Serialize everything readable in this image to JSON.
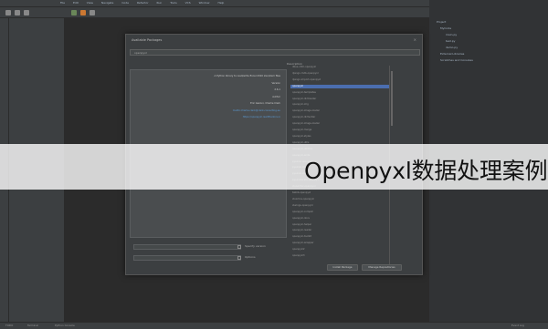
{
  "menu": [
    "File",
    "Edit",
    "View",
    "Navigate",
    "Code",
    "Refactor",
    "Run",
    "Tools",
    "VCS",
    "Window",
    "Help"
  ],
  "window_title": "PyCharm",
  "dialog": {
    "title": "Available Packages",
    "search_value": "openpyxl",
    "description_header": "Description",
    "description_lines": [
      "A Python library to read/write Excel 2010 xlsx/xlsm files",
      "Version",
      "2.6.1",
      "Author",
      "Eric Gazoni, Charlie Clark"
    ],
    "description_links": [
      "mailto:charlie.clark@clark-consulting.eu",
      "https://openpyxl.readthedocs.io"
    ],
    "packages": [
      "dbus-ntlm-openpyxl",
      "django-mdb-openpyxl",
      "django-import-openpyxl",
      "openpyxl",
      "openpyxl-templates",
      "openpyxl-dictreader",
      "openpyxl-img",
      "openpyxl-image-loader",
      "openpyxl-dictwriter",
      "openpyxl-image-loader",
      "openpyxl-merge",
      "openpyxl-styles",
      "openpyxl-utils",
      "openpyxl-utilities",
      "openpyxl-write",
      "pyexcel-openpyxl",
      "pyexcel-xlsx",
      "pyexcel-xlsxw",
      "pyexcelerate-openpyxl",
      "xlsxwriter-openpyxl",
      "tablib-openpyxl",
      "xlsx2csv-openpyxl",
      "xlwings-openpyxl",
      "openpyxl-compat",
      "openpyxl-docs",
      "openpyxl-helper",
      "openpyxl-reader",
      "openpyxl-toolkit",
      "openpyxl-wrapper",
      "openpyxl2",
      "openpyxl3"
    ],
    "selected_index": 3,
    "specify_version_label": "Specify version",
    "options_label": "Options",
    "install_button": "Install Package",
    "manage_button": "Manage Repositories"
  },
  "project_tree": [
    "Project",
    "MyCode",
    "main.py",
    "test.py",
    "demo.py",
    "External Libraries",
    "Scratches and Consoles"
  ],
  "status_items": [
    "TODO",
    "Terminal",
    "Python Console",
    "Event Log"
  ],
  "banner_text": "Openpyxl数据处理案例"
}
